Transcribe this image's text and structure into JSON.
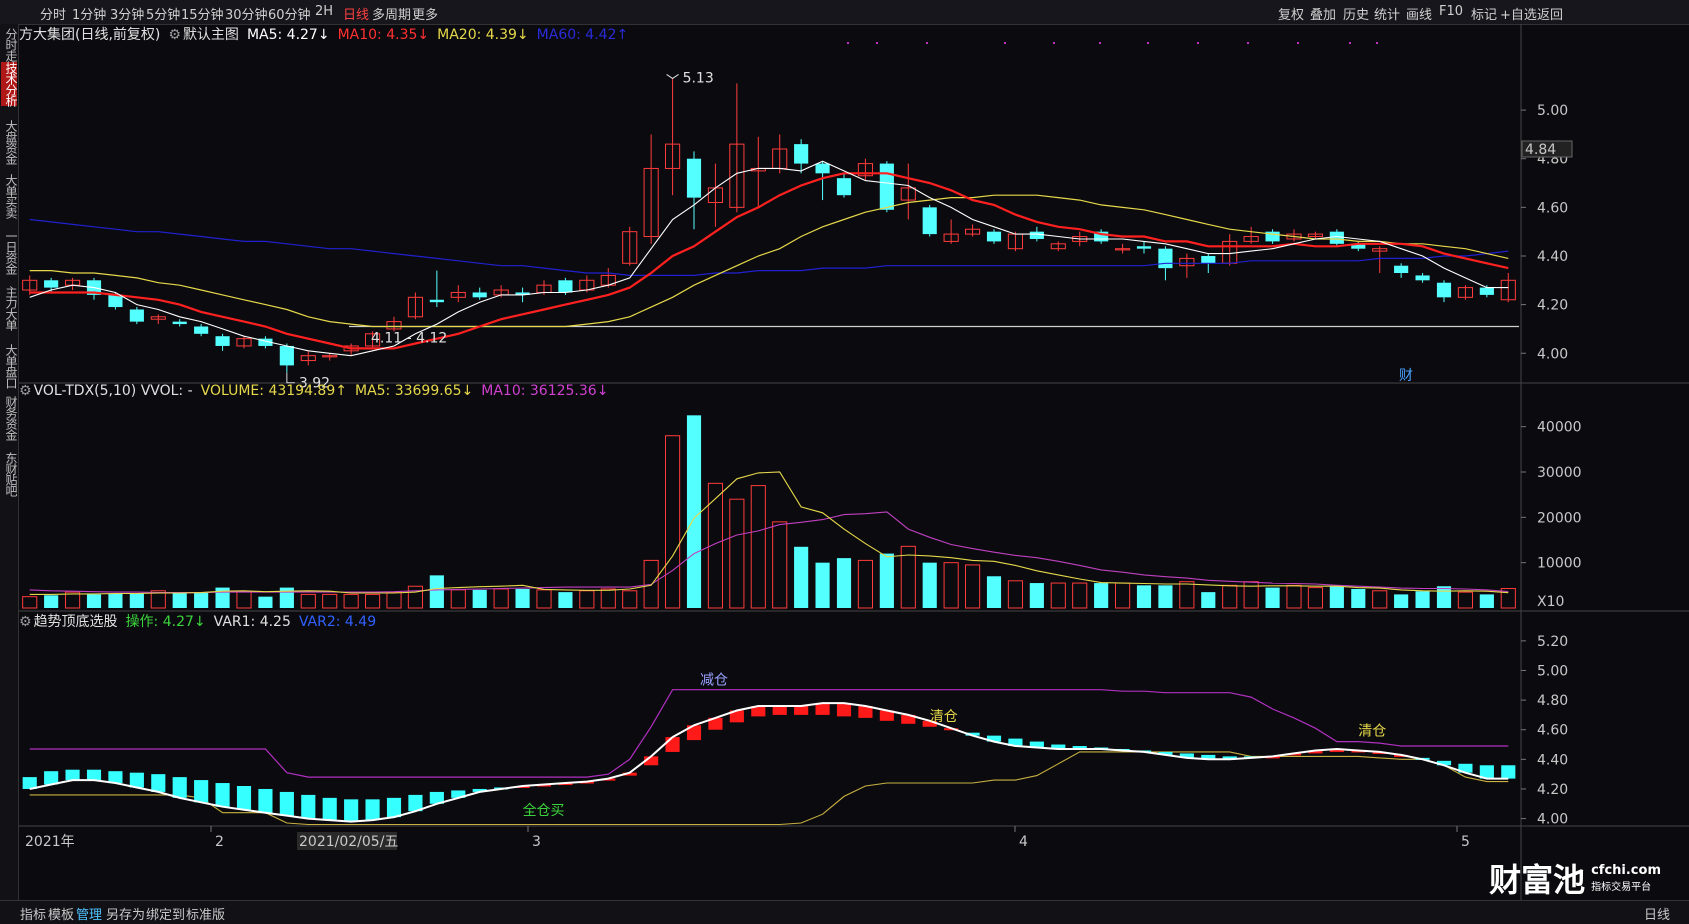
{
  "topbar": {
    "tabs": [
      "分时",
      "1分钟",
      "3分钟",
      "5分钟",
      "15分钟",
      "30分钟",
      "60分钟",
      "2H",
      "日线",
      "多周期",
      "更多"
    ],
    "active_tab": "日线",
    "right_buttons": [
      "复权",
      "叠加",
      "历史",
      "统计",
      "画线",
      "F10",
      "标记",
      "+自选",
      "返回"
    ]
  },
  "leftnav": {
    "items": [
      "分时走势",
      "技术分析",
      "大盘资金",
      "大单买卖",
      "一日资金",
      "主力大单",
      "大单盘口",
      "财务资金",
      "东财贴吧"
    ],
    "active": "技术分析"
  },
  "main_header": {
    "stock": "方大集团(日线,前复权)",
    "template": "默认主图",
    "ma5": "MA5: 4.27↓",
    "ma10": "MA10: 4.35↓",
    "ma20": "MA20: 4.39↓",
    "ma60": "MA60: 4.42↑"
  },
  "vol_header": {
    "name": "VOL-TDX(5,10) VVOL: -",
    "volume": "VOLUME: 43194.89↑",
    "ma5": "MA5: 33699.65↓",
    "ma10": "MA10: 36125.36↓"
  },
  "ind_header": {
    "name": "趋势顶底选股",
    "op": "操作: 4.27↓",
    "var1": "VAR1: 4.25",
    "var2": "VAR2: 4.49"
  },
  "price_axis": [
    "5.00",
    "4.80",
    "4.60",
    "4.40",
    "4.20",
    "4.00"
  ],
  "current_price": "4.84",
  "vol_axis": [
    "40000",
    "30000",
    "20000",
    "10000"
  ],
  "vol_unit": "X10",
  "ind_axis": [
    "5.20",
    "5.00",
    "4.80",
    "4.60",
    "4.40",
    "4.20",
    "4.00"
  ],
  "x_labels": [
    "2021年",
    "2",
    "2021/02/05/五",
    "3",
    "4",
    "5"
  ],
  "annotations": {
    "high": "5.13",
    "low": "3.92",
    "range": "4.11 - 4.12",
    "fin_marker": "财",
    "reduce": "减仓",
    "clear1": "清仓",
    "clear2": "清仓",
    "buy": "全仓买"
  },
  "bottombar": {
    "items": [
      "指标",
      "模板",
      "管理",
      "另存为",
      "绑定到",
      "标准版"
    ],
    "active": "管理",
    "period": "日线"
  },
  "watermark": {
    "brand": "财富池",
    "site": "cfchi.com",
    "tag": "指标交易平台"
  },
  "colors": {
    "up": "#ff3b3b",
    "down": "#54ffff",
    "ma5": "#ffffff",
    "ma10": "#ff2020",
    "ma20": "#e6d84a",
    "ma60": "#2020d0",
    "vma10": "#c040c0",
    "op_green": "#3cd23c",
    "var2": "#3060ff"
  },
  "chart_data": {
    "type": "candlestick",
    "candles": [
      {
        "o": 4.26,
        "c": 4.3,
        "h": 4.32,
        "l": 4.24
      },
      {
        "o": 4.3,
        "c": 4.27,
        "h": 4.31,
        "l": 4.25
      },
      {
        "o": 4.28,
        "c": 4.3,
        "h": 4.31,
        "l": 4.26
      },
      {
        "o": 4.3,
        "c": 4.24,
        "h": 4.31,
        "l": 4.22
      },
      {
        "o": 4.24,
        "c": 4.19,
        "h": 4.25,
        "l": 4.18
      },
      {
        "o": 4.18,
        "c": 4.13,
        "h": 4.19,
        "l": 4.12
      },
      {
        "o": 4.14,
        "c": 4.15,
        "h": 4.16,
        "l": 4.12
      },
      {
        "o": 4.13,
        "c": 4.12,
        "h": 4.14,
        "l": 4.11
      },
      {
        "o": 4.11,
        "c": 4.08,
        "h": 4.12,
        "l": 4.07
      },
      {
        "o": 4.07,
        "c": 4.03,
        "h": 4.08,
        "l": 4.01
      },
      {
        "o": 4.03,
        "c": 4.06,
        "h": 4.07,
        "l": 4.02
      },
      {
        "o": 4.06,
        "c": 4.03,
        "h": 4.07,
        "l": 4.02
      },
      {
        "o": 4.03,
        "c": 3.95,
        "h": 4.04,
        "l": 3.92
      },
      {
        "o": 3.97,
        "c": 3.99,
        "h": 4.01,
        "l": 3.95
      },
      {
        "o": 3.99,
        "c": 3.99,
        "h": 4.0,
        "l": 3.97
      },
      {
        "o": 4.01,
        "c": 4.03,
        "h": 4.04,
        "l": 3.99
      },
      {
        "o": 4.03,
        "c": 4.08,
        "h": 4.09,
        "l": 4.02
      },
      {
        "o": 4.1,
        "c": 4.13,
        "h": 4.15,
        "l": 4.09
      },
      {
        "o": 4.15,
        "c": 4.23,
        "h": 4.25,
        "l": 4.14
      },
      {
        "o": 4.22,
        "c": 4.21,
        "h": 4.34,
        "l": 4.19
      },
      {
        "o": 4.23,
        "c": 4.25,
        "h": 4.28,
        "l": 4.21
      },
      {
        "o": 4.25,
        "c": 4.23,
        "h": 4.27,
        "l": 4.22
      },
      {
        "o": 4.24,
        "c": 4.26,
        "h": 4.28,
        "l": 4.23
      },
      {
        "o": 4.25,
        "c": 4.24,
        "h": 4.27,
        "l": 4.21
      },
      {
        "o": 4.25,
        "c": 4.28,
        "h": 4.3,
        "l": 4.24
      },
      {
        "o": 4.3,
        "c": 4.25,
        "h": 4.31,
        "l": 4.24
      },
      {
        "o": 4.26,
        "c": 4.3,
        "h": 4.32,
        "l": 4.25
      },
      {
        "o": 4.28,
        "c": 4.32,
        "h": 4.35,
        "l": 4.27
      },
      {
        "o": 4.37,
        "c": 4.5,
        "h": 4.52,
        "l": 4.36
      },
      {
        "o": 4.48,
        "c": 4.76,
        "h": 4.9,
        "l": 4.45
      },
      {
        "o": 4.76,
        "c": 4.86,
        "h": 5.13,
        "l": 4.65
      },
      {
        "o": 4.8,
        "c": 4.64,
        "h": 4.83,
        "l": 4.51
      },
      {
        "o": 4.62,
        "c": 4.68,
        "h": 4.78,
        "l": 4.52
      },
      {
        "o": 4.6,
        "c": 4.86,
        "h": 5.11,
        "l": 4.58
      },
      {
        "o": 4.75,
        "c": 4.76,
        "h": 4.89,
        "l": 4.6
      },
      {
        "o": 4.76,
        "c": 4.84,
        "h": 4.9,
        "l": 4.74
      },
      {
        "o": 4.86,
        "c": 4.78,
        "h": 4.88,
        "l": 4.74
      },
      {
        "o": 4.78,
        "c": 4.74,
        "h": 4.79,
        "l": 4.63
      },
      {
        "o": 4.72,
        "c": 4.65,
        "h": 4.74,
        "l": 4.64
      },
      {
        "o": 4.73,
        "c": 4.78,
        "h": 4.8,
        "l": 4.71
      },
      {
        "o": 4.78,
        "c": 4.59,
        "h": 4.79,
        "l": 4.58
      },
      {
        "o": 4.63,
        "c": 4.68,
        "h": 4.78,
        "l": 4.55
      },
      {
        "o": 4.6,
        "c": 4.49,
        "h": 4.61,
        "l": 4.48
      },
      {
        "o": 4.46,
        "c": 4.49,
        "h": 4.55,
        "l": 4.45
      },
      {
        "o": 4.49,
        "c": 4.51,
        "h": 4.53,
        "l": 4.48
      },
      {
        "o": 4.5,
        "c": 4.46,
        "h": 4.51,
        "l": 4.45
      },
      {
        "o": 4.43,
        "c": 4.49,
        "h": 4.5,
        "l": 4.42
      },
      {
        "o": 4.5,
        "c": 4.47,
        "h": 4.52,
        "l": 4.46
      },
      {
        "o": 4.43,
        "c": 4.45,
        "h": 4.46,
        "l": 4.42
      },
      {
        "o": 4.46,
        "c": 4.48,
        "h": 4.5,
        "l": 4.44
      },
      {
        "o": 4.5,
        "c": 4.46,
        "h": 4.51,
        "l": 4.45
      },
      {
        "o": 4.43,
        "c": 4.43,
        "h": 4.45,
        "l": 4.41
      },
      {
        "o": 4.44,
        "c": 4.43,
        "h": 4.46,
        "l": 4.41
      },
      {
        "o": 4.43,
        "c": 4.35,
        "h": 4.44,
        "l": 4.3
      },
      {
        "o": 4.36,
        "c": 4.39,
        "h": 4.41,
        "l": 4.31
      },
      {
        "o": 4.4,
        "c": 4.37,
        "h": 4.41,
        "l": 4.33
      },
      {
        "o": 4.37,
        "c": 4.46,
        "h": 4.49,
        "l": 4.36
      },
      {
        "o": 4.46,
        "c": 4.48,
        "h": 4.52,
        "l": 4.45
      },
      {
        "o": 4.5,
        "c": 4.46,
        "h": 4.51,
        "l": 4.45
      },
      {
        "o": 4.47,
        "c": 4.49,
        "h": 4.51,
        "l": 4.46
      },
      {
        "o": 4.48,
        "c": 4.49,
        "h": 4.5,
        "l": 4.47
      },
      {
        "o": 4.5,
        "c": 4.45,
        "h": 4.51,
        "l": 4.44
      },
      {
        "o": 4.45,
        "c": 4.43,
        "h": 4.46,
        "l": 4.42
      },
      {
        "o": 4.42,
        "c": 4.43,
        "h": 4.44,
        "l": 4.33
      },
      {
        "o": 4.36,
        "c": 4.33,
        "h": 4.37,
        "l": 4.31
      },
      {
        "o": 4.32,
        "c": 4.3,
        "h": 4.33,
        "l": 4.29
      },
      {
        "o": 4.29,
        "c": 4.23,
        "h": 4.3,
        "l": 4.21
      },
      {
        "o": 4.23,
        "c": 4.27,
        "h": 4.28,
        "l": 4.22
      },
      {
        "o": 4.27,
        "c": 4.24,
        "h": 4.28,
        "l": 4.23
      },
      {
        "o": 4.22,
        "c": 4.3,
        "h": 4.33,
        "l": 4.21
      }
    ],
    "ma5": [
      4.23,
      4.26,
      4.28,
      4.27,
      4.25,
      4.2,
      4.18,
      4.15,
      4.13,
      4.1,
      4.07,
      4.05,
      4.03,
      4.01,
      4.0,
      3.99,
      4.01,
      4.03,
      4.08,
      4.12,
      4.17,
      4.21,
      4.24,
      4.24,
      4.25,
      4.25,
      4.26,
      4.28,
      4.31,
      4.43,
      4.55,
      4.61,
      4.68,
      4.74,
      4.76,
      4.76,
      4.75,
      4.79,
      4.75,
      4.71,
      4.7,
      4.69,
      4.64,
      4.6,
      4.55,
      4.52,
      4.49,
      4.49,
      4.48,
      4.47,
      4.47,
      4.47,
      4.46,
      4.45,
      4.43,
      4.41,
      4.41,
      4.42,
      4.43,
      4.45,
      4.47,
      4.48,
      4.47,
      4.46,
      4.43,
      4.4,
      4.35,
      4.31,
      4.27,
      4.27
    ],
    "ma10": [
      4.25,
      4.25,
      4.25,
      4.25,
      4.24,
      4.23,
      4.22,
      4.2,
      4.17,
      4.15,
      4.13,
      4.11,
      4.08,
      4.06,
      4.04,
      4.02,
      4.02,
      4.02,
      4.04,
      4.06,
      4.08,
      4.11,
      4.14,
      4.16,
      4.18,
      4.2,
      4.22,
      4.24,
      4.27,
      4.33,
      4.4,
      4.44,
      4.5,
      4.56,
      4.6,
      4.65,
      4.69,
      4.72,
      4.74,
      4.74,
      4.74,
      4.72,
      4.7,
      4.67,
      4.63,
      4.61,
      4.57,
      4.54,
      4.52,
      4.51,
      4.49,
      4.48,
      4.48,
      4.46,
      4.46,
      4.44,
      4.44,
      4.44,
      4.44,
      4.45,
      4.44,
      4.44,
      4.45,
      4.45,
      4.45,
      4.44,
      4.41,
      4.39,
      4.37,
      4.35
    ],
    "ma20": [
      4.34,
      4.34,
      4.33,
      4.33,
      4.32,
      4.31,
      4.29,
      4.28,
      4.26,
      4.24,
      4.22,
      4.2,
      4.18,
      4.15,
      4.13,
      4.12,
      4.11,
      4.11,
      4.11,
      4.11,
      4.11,
      4.11,
      4.11,
      4.11,
      4.11,
      4.11,
      4.12,
      4.13,
      4.15,
      4.19,
      4.23,
      4.28,
      4.32,
      4.36,
      4.4,
      4.43,
      4.48,
      4.52,
      4.55,
      4.58,
      4.6,
      4.62,
      4.63,
      4.64,
      4.64,
      4.65,
      4.65,
      4.65,
      4.64,
      4.63,
      4.61,
      4.6,
      4.59,
      4.57,
      4.55,
      4.53,
      4.51,
      4.5,
      4.49,
      4.48,
      4.47,
      4.47,
      4.46,
      4.46,
      4.45,
      4.45,
      4.44,
      4.43,
      4.41,
      4.39
    ],
    "ma60": [
      4.55,
      4.54,
      4.53,
      4.52,
      4.51,
      4.5,
      4.5,
      4.49,
      4.48,
      4.47,
      4.46,
      4.46,
      4.45,
      4.44,
      4.43,
      4.43,
      4.42,
      4.41,
      4.4,
      4.39,
      4.38,
      4.37,
      4.36,
      4.36,
      4.35,
      4.34,
      4.33,
      4.33,
      4.32,
      4.32,
      4.32,
      4.32,
      4.33,
      4.33,
      4.34,
      4.34,
      4.34,
      4.35,
      4.35,
      4.35,
      4.36,
      4.36,
      4.36,
      4.36,
      4.36,
      4.36,
      4.36,
      4.36,
      4.36,
      4.36,
      4.36,
      4.36,
      4.36,
      4.37,
      4.37,
      4.37,
      4.37,
      4.38,
      4.38,
      4.38,
      4.38,
      4.38,
      4.38,
      4.39,
      4.39,
      4.39,
      4.4,
      4.4,
      4.41,
      4.42
    ],
    "volume": [
      2500,
      2800,
      3500,
      3000,
      3200,
      3300,
      3800,
      3500,
      3500,
      4500,
      3700,
      2500,
      4500,
      3000,
      3000,
      3000,
      3000,
      3500,
      4800,
      7200,
      4000,
      4000,
      4200,
      4200,
      4000,
      3500,
      3800,
      4200,
      3800,
      10500,
      38000,
      42500,
      27500,
      24000,
      27000,
      19000,
      13500,
      10000,
      11000,
      10500,
      12000,
      13600,
      10000,
      10000,
      9500,
      7000,
      6000,
      5500,
      5500,
      5500,
      5500,
      5500,
      5000,
      5000,
      5800,
      3500,
      5000,
      5800,
      4500,
      5000,
      4500,
      4800,
      4200,
      3800,
      3000,
      3700,
      4800,
      3500,
      3000,
      4300
    ],
    "vma5": [
      3000,
      3000,
      3100,
      3100,
      3200,
      3200,
      3300,
      3300,
      3400,
      3700,
      3800,
      3600,
      3700,
      3800,
      3700,
      3300,
      3300,
      3300,
      3500,
      4300,
      4500,
      4700,
      4800,
      5000,
      4100,
      4000,
      3900,
      3900,
      4200,
      5000,
      11500,
      19800,
      24100,
      28500,
      29800,
      30000,
      22300,
      21000,
      17400,
      14200,
      11300,
      11700,
      11500,
      11100,
      10500,
      10300,
      9400,
      8200,
      7300,
      6400,
      5600,
      5500,
      5400,
      5300,
      5300,
      5100,
      4900,
      4800,
      4900,
      4900,
      4800,
      4800,
      4500,
      4400,
      4000,
      3800,
      3700,
      3800,
      3700,
      3370
    ],
    "vma10": [
      4000,
      3800,
      3700,
      3600,
      3500,
      3500,
      3400,
      3400,
      3400,
      3500,
      3500,
      3500,
      3500,
      3500,
      3500,
      3500,
      3500,
      3600,
      3800,
      4000,
      4100,
      4200,
      4300,
      4400,
      4500,
      4600,
      4600,
      4600,
      4600,
      5200,
      8300,
      12000,
      14200,
      16100,
      17000,
      18400,
      18900,
      19500,
      20600,
      20800,
      21200,
      17400,
      15600,
      14000,
      13100,
      12300,
      11600,
      11100,
      10300,
      9400,
      8400,
      7900,
      7300,
      6900,
      6600,
      6100,
      5900,
      5700,
      5500,
      5400,
      5300,
      5000,
      4800,
      4600,
      4400,
      4300,
      4300,
      4200,
      4000,
      3610
    ],
    "op": [
      4.2,
      4.23,
      4.26,
      4.26,
      4.24,
      4.21,
      4.18,
      4.14,
      4.11,
      4.08,
      4.06,
      4.04,
      4.02,
      4.0,
      3.99,
      3.98,
      3.99,
      4.01,
      4.05,
      4.1,
      4.14,
      4.18,
      4.2,
      4.22,
      4.23,
      4.24,
      4.25,
      4.27,
      4.31,
      4.42,
      4.55,
      4.63,
      4.68,
      4.73,
      4.76,
      4.76,
      4.76,
      4.78,
      4.78,
      4.76,
      4.73,
      4.7,
      4.66,
      4.61,
      4.56,
      4.52,
      4.49,
      4.48,
      4.47,
      4.47,
      4.47,
      4.46,
      4.45,
      4.43,
      4.41,
      4.4,
      4.4,
      4.41,
      4.42,
      4.44,
      4.46,
      4.47,
      4.46,
      4.45,
      4.43,
      4.4,
      4.36,
      4.31,
      4.27,
      4.27
    ],
    "var1": [
      4.28,
      4.32,
      4.33,
      4.33,
      4.32,
      4.31,
      4.3,
      4.28,
      4.26,
      4.24,
      4.22,
      4.2,
      4.18,
      4.16,
      4.14,
      4.13,
      4.13,
      4.14,
      4.16,
      4.18,
      4.19,
      4.2,
      4.21,
      4.22,
      4.23,
      4.24,
      4.25,
      4.26,
      4.29,
      4.36,
      4.45,
      4.53,
      4.6,
      4.65,
      4.69,
      4.7,
      4.7,
      4.7,
      4.69,
      4.68,
      4.66,
      4.64,
      4.62,
      4.6,
      4.58,
      4.56,
      4.54,
      4.52,
      4.5,
      4.49,
      4.48,
      4.47,
      4.46,
      4.45,
      4.44,
      4.43,
      4.42,
      4.42,
      4.42,
      4.43,
      4.44,
      4.45,
      4.45,
      4.44,
      4.43,
      4.41,
      4.39,
      4.37,
      4.36,
      4.36
    ],
    "upper": [
      4.47,
      4.47,
      4.47,
      4.47,
      4.47,
      4.47,
      4.47,
      4.47,
      4.47,
      4.47,
      4.47,
      4.47,
      4.31,
      4.28,
      4.28,
      4.28,
      4.28,
      4.28,
      4.28,
      4.28,
      4.28,
      4.28,
      4.28,
      4.28,
      4.28,
      4.28,
      4.28,
      4.3,
      4.4,
      4.62,
      4.87,
      4.87,
      4.87,
      4.87,
      4.87,
      4.87,
      4.87,
      4.87,
      4.87,
      4.87,
      4.87,
      4.87,
      4.87,
      4.87,
      4.87,
      4.87,
      4.87,
      4.87,
      4.87,
      4.87,
      4.87,
      4.86,
      4.86,
      4.85,
      4.85,
      4.85,
      4.85,
      4.82,
      4.74,
      4.68,
      4.61,
      4.52,
      4.52,
      4.51,
      4.49,
      4.49,
      4.49,
      4.49,
      4.49,
      4.49
    ],
    "lower": [
      4.16,
      4.16,
      4.16,
      4.16,
      4.16,
      4.16,
      4.16,
      4.16,
      4.14,
      4.04,
      4.04,
      4.04,
      3.97,
      3.96,
      3.96,
      3.96,
      3.96,
      3.96,
      3.96,
      3.96,
      3.96,
      3.96,
      3.96,
      3.96,
      3.96,
      3.96,
      3.96,
      3.96,
      3.96,
      3.96,
      3.96,
      3.96,
      3.96,
      3.96,
      3.96,
      3.96,
      3.97,
      4.03,
      4.15,
      4.22,
      4.24,
      4.24,
      4.24,
      4.24,
      4.24,
      4.26,
      4.26,
      4.29,
      4.37,
      4.45,
      4.45,
      4.45,
      4.45,
      4.45,
      4.45,
      4.45,
      4.45,
      4.42,
      4.42,
      4.42,
      4.42,
      4.42,
      4.42,
      4.41,
      4.4,
      4.4,
      4.36,
      4.28,
      4.25,
      4.25
    ],
    "price_ylim": [
      3.89,
      5.28
    ],
    "vol_ylim": [
      0,
      45000
    ],
    "ind_ylim": [
      3.95,
      5.28
    ]
  }
}
